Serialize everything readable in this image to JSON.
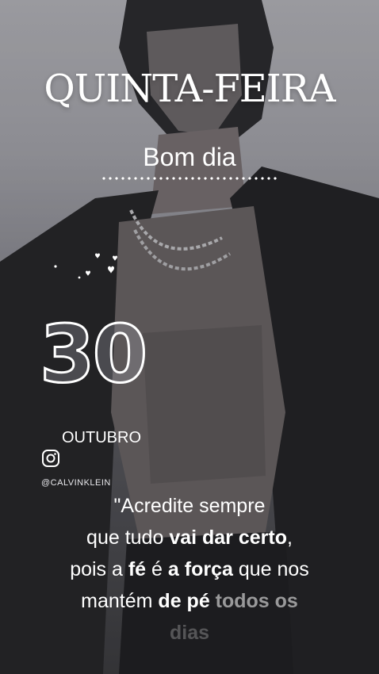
{
  "post": {
    "day": "QUINTA-FEIRA",
    "greeting": "Bom dia",
    "date_number": "30",
    "month": "OUTUBRO",
    "handle": "@CALVINKLEIN",
    "quote": {
      "line1": "\"Acredite sempre",
      "line2_a": "que tudo ",
      "line2_b": "vai dar certo",
      "line2_c": ",",
      "line3_a": "pois a ",
      "line3_b": "fé",
      "line3_c": " é ",
      "line3_d": "a força",
      "line3_e": " que nos",
      "line4_a": "mantém ",
      "line4_b": "de pé",
      "line4_c": " todos os",
      "line5": "dias"
    }
  },
  "icons": {
    "instagram": "instagram-icon",
    "hearts": "hearts-icon"
  },
  "colors": {
    "text": "#ffffff",
    "background": "#4a4a4e"
  }
}
